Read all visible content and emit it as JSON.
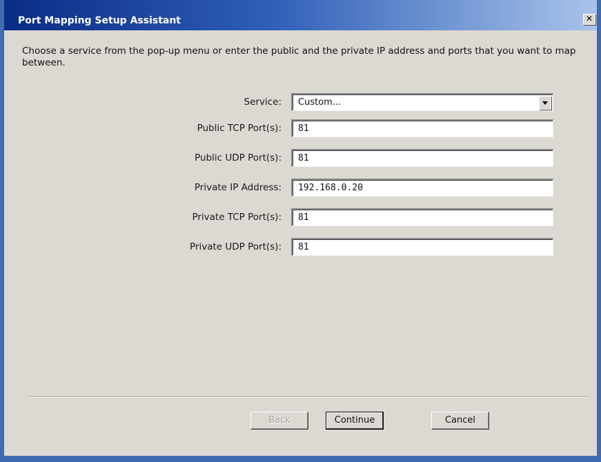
{
  "window": {
    "title": "Port Mapping Setup Assistant",
    "close_glyph": "✕"
  },
  "intro_text": "Choose a service from the pop-up menu or enter the public and the private IP address and ports that you want to map between.",
  "form": {
    "service": {
      "label": "Service:",
      "value": "Custom..."
    },
    "public_tcp": {
      "label": "Public TCP Port(s):",
      "value": "81"
    },
    "public_udp": {
      "label": "Public UDP Port(s):",
      "value": "81"
    },
    "private_ip": {
      "label": "Private IP Address:",
      "value": "192.168.0.20"
    },
    "private_tcp": {
      "label": "Private TCP Port(s):",
      "value": "81"
    },
    "private_udp": {
      "label": "Private UDP Port(s):",
      "value": "81"
    }
  },
  "buttons": {
    "back": "Back",
    "continue": "Continue",
    "cancel": "Cancel"
  },
  "colors": {
    "title_bar_start": "#0a2c86",
    "title_bar_end": "#a9c3ea",
    "dialog_face": "#dcd9d3"
  },
  "icons": {
    "close": "close-icon",
    "dropdown": "chevron-down-icon"
  }
}
